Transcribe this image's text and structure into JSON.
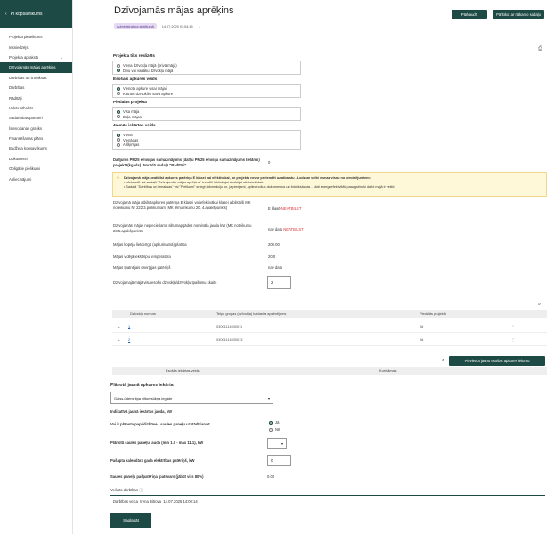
{
  "sidebar": {
    "back_label": "Pi kopsavilkums",
    "items": [
      {
        "label": "Projekta pieteikums",
        "chevron": false,
        "active": false
      },
      {
        "label": "Iesniedzējs",
        "chevron": false,
        "active": false
      },
      {
        "label": "Projekta apraksts",
        "chevron": true,
        "active": false
      },
      {
        "label": "Dzīvojamās mājas aprēķins",
        "chevron": false,
        "active": true
      },
      {
        "label": "Darbības un izmaksas",
        "chevron": false,
        "active": false
      },
      {
        "label": "Darbības",
        "chevron": false,
        "active": false
      },
      {
        "label": "Rādītāji",
        "chevron": false,
        "active": false
      },
      {
        "label": "Valsts atbalsts",
        "chevron": false,
        "active": false
      },
      {
        "label": "Sadarbības partneri",
        "chevron": false,
        "active": false
      },
      {
        "label": "Īstenošanas grafiks",
        "chevron": false,
        "active": false
      },
      {
        "label": "Finansēšanas plāns",
        "chevron": false,
        "active": false
      },
      {
        "label": "Budžeta kopsavilkums",
        "chevron": false,
        "active": false
      },
      {
        "label": "Dokumenti",
        "chevron": false,
        "active": false
      },
      {
        "label": "Obligātie pielikumi",
        "chevron": false,
        "active": false
      },
      {
        "label": "Apliecinājumi",
        "chevron": false,
        "active": false
      }
    ]
  },
  "header": {
    "title": "Dzīvojamās mājas aprēķins",
    "badge": "Administratora skatījumā",
    "date": "14.07.2025 03:54:15",
    "pdf_button": "Pārbaudīt",
    "copy_button": "Pārlūkot ar nākamo sadaļu"
  },
  "form": {
    "s1_title": "Projekta tiks realizēts",
    "s1_opts": [
      "Viena dzīvokļa mājā (privātmāja)",
      "Divu vai vairāku dzīvokļu mājā"
    ],
    "s2_title": "Esošais apkures veids",
    "s2_opts": [
      "Vienota apkure visai mājai",
      "Katram dzīvoklim sava apkure"
    ],
    "s3_title": "Piedalās projektā",
    "s3_opts": [
      "Visa māja",
      "Daļa mājas"
    ],
    "s4_title": "Jaunās iekārtas veids",
    "s4_opts": [
      "Viena",
      "Vienādas",
      "Atšķirīgas"
    ],
    "pm25_label": "Dalījums PM25 emisijas samazinājums (dalīju PM25 emisiju samazinājums lielāms) projektā(kgads). Norādā sadaļā \"Rādītāji\"",
    "pm25_value": "0",
    "warning_line1": "Dzīvojamā māja neatbilst apkures patēriņa E klasei vai efektivākai, un projekts nevar pretendēt uz atbalstu . Lodzam veikt visnaz visnu no precizējumiem:",
    "warning_line2": "pārbaudīt vai sadaļā \"Dzīvojamās mājas aprēķins\" ievadīti faktiskajai situācijai atbilstoši dati.",
    "warning_line3": "Sadaļā \"Darbības un izmaksas\" vai \"Pielikumi\" sniegt informāciju un, ja pieejami, apliecinošus dokumentus un fotofiksācijas - kādi energoefektivitāti paaugstinoši darbi mājā ir veikti.",
    "eclass_label": "Dzīvojamā māja atbilst apkures patēriņa E klasei vai efektivākai klasei atbilstoši MK noteikumu Nr 222 3.pielikumam (MK lēmumkumu 20. 4.apakšpunkts)",
    "eclass_prefix": "E klasē",
    "eclass_status": "NEATBILST",
    "heatpower_label": "Dzīvojamās mājas nepieciešamā siltumapgādes nominālā jauda kW (MK noteikumu 23.5.apakšpunkts)",
    "heatpower_prefix": "nav datu",
    "heatpower_status": "NEATBILST",
    "area_label": "Mājas kopējā lietderīgā (apkurināmā) platība",
    "area_value": "200.00",
    "temp_label": "Mājas vidējā iekštelpu temperatūra",
    "temp_value": "20.0",
    "energy_label": "Mājas īpatnējais enerģijas patēriņš",
    "energy_value": "nav datu",
    "units_label": "Dzīvojamajā mājā visu esošo dzīvokļu/dzīvokļu īpašumu skaits",
    "units_value": "2"
  },
  "table1": {
    "headers": [
      "Dzīvokļa numurs",
      "Telpu grupas (dzīvokļa) kadastra apzīmējums",
      "Piedalās projektā"
    ],
    "rows": [
      {
        "num": "1",
        "cadastre": "03001111030011",
        "part": "Jā"
      },
      {
        "num": "2",
        "cadastre": "03001111030013",
        "part": "Jā"
      }
    ]
  },
  "add_button": "Pievienot jaunu esošās apkures iekārtu",
  "table2": {
    "headers": [
      "Esošās iekārtas veids",
      "Kurināmais"
    ]
  },
  "planned": {
    "title": "Plānotā jaunā apkures iekārta",
    "select_value": "Gaiss-ūdens tipa siltumsūkņa iegāde",
    "power_label": "Indikatīvā jaunā iekārtas jauda, kW",
    "solar_q": "Vai ir plānota papildizbūve - saules paneļu uzstādīšana?",
    "yes": "Jā",
    "no": "Nē",
    "solar_power_label": "Plānotā saules paneļu jauda (min 1.0 - max 11.1), kW",
    "yearly_label": "Pašāpta kalendāra gada elektrības patēriņš, kW",
    "yearly_value": "0",
    "self_label": "Saules paneļu pašpatēriņa īpatsvars (jābūt virs 80%)",
    "self_value": "0.00"
  },
  "footer": {
    "done_label": "Veiktās darbības",
    "done_by_label": "Darbības veica",
    "done_by": "Irena Bitrova",
    "done_date": "14.07.2025 14:00:14",
    "save_button": "Saglabāt"
  }
}
